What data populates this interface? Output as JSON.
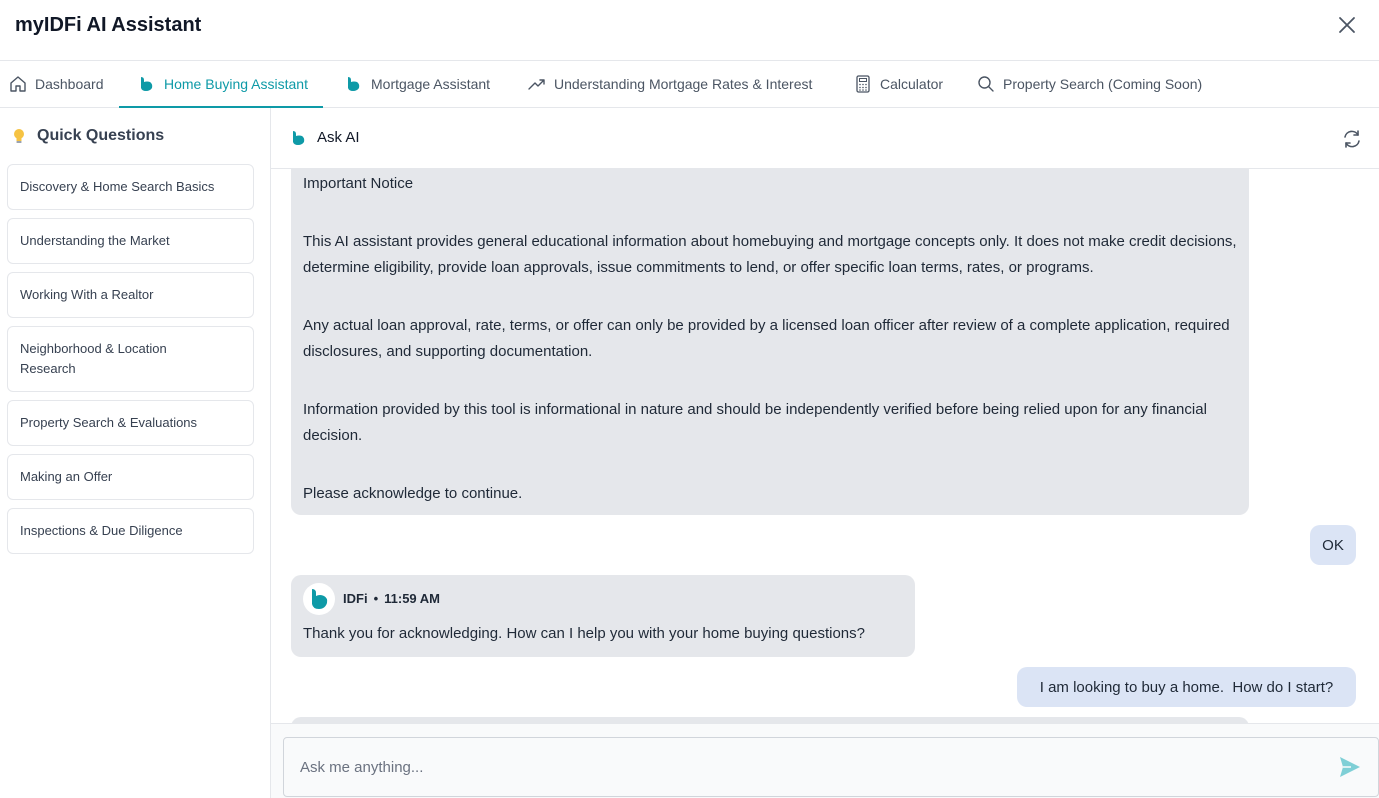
{
  "app": {
    "title": "myIDFi AI Assistant"
  },
  "tabs": [
    {
      "label": "Dashboard",
      "icon": "home-icon"
    },
    {
      "label": "Home Buying Assistant",
      "icon": "idfi-logo-icon",
      "active": true
    },
    {
      "label": "Mortgage Assistant",
      "icon": "idfi-logo-icon"
    },
    {
      "label": "Understanding Mortgage Rates & Interest",
      "icon": "trending-up-icon"
    },
    {
      "label": "Calculator",
      "icon": "calculator-icon"
    },
    {
      "label": "Property Search (Coming Soon)",
      "icon": "search-icon"
    }
  ],
  "sidebar": {
    "heading": "Quick Questions",
    "items": [
      {
        "label": "Discovery & Home Search Basics"
      },
      {
        "label": "Understanding the Market"
      },
      {
        "label": "Working With a Realtor"
      },
      {
        "label": "Neighborhood & Location Research"
      },
      {
        "label": "Property Search & Evaluations"
      },
      {
        "label": "Making an Offer"
      },
      {
        "label": "Inspections & Due Diligence"
      }
    ]
  },
  "chat": {
    "title": "Ask AI",
    "notice": {
      "heading": "Important Notice",
      "p1": "This AI assistant provides general educational information about homebuying and mortgage concepts only. It does not make credit decisions, determine eligibility, provide loan approvals, issue commitments to lend, or offer specific loan terms, rates, or programs.",
      "p2": "Any actual loan approval, rate, terms, or offer can only be provided by a licensed loan officer after review of a complete application, required disclosures, and supporting documentation.",
      "p3": "Information provided by this tool is informational in nature and should be independently verified before being relied upon for any financial decision.",
      "p4": "Please acknowledge to continue."
    },
    "user_msg_1": "OK",
    "ai_msg": {
      "sender": "IDFi",
      "separator": "•",
      "time": "11:59 AM",
      "text": "Thank you for acknowledging. How can I help you with your home buying questions?"
    },
    "user_msg_2": "I am looking to buy a home.  How do I start?",
    "input_placeholder": "Ask me anything..."
  },
  "colors": {
    "accent": "#0e9aa7",
    "ai_bubble": "#e5e7eb",
    "user_bubble": "#dbe4f5"
  }
}
